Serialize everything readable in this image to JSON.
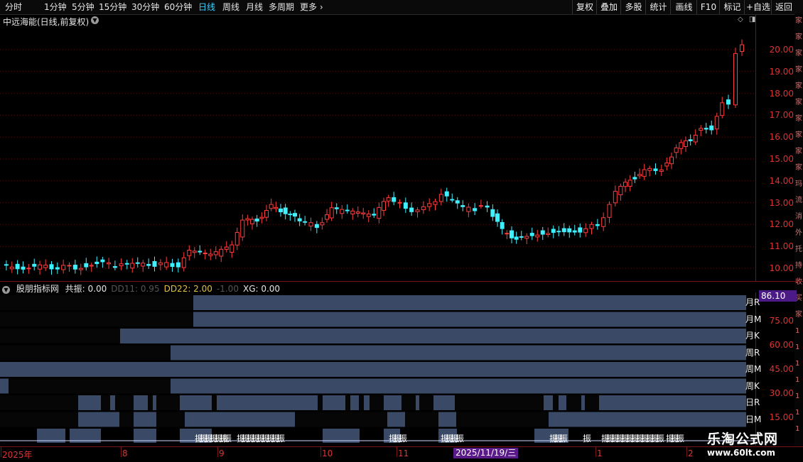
{
  "toolbar": {
    "periods": [
      "分时",
      "1分钟",
      "5分钟",
      "15分钟",
      "30分钟",
      "60分钟",
      "日线",
      "周线",
      "月线",
      "多周期",
      "更多"
    ],
    "active_period": "日线",
    "right_buttons": [
      "复权",
      "叠加",
      "多股",
      "统计",
      "画线",
      "F10",
      "标记",
      "+自选",
      "返回"
    ]
  },
  "stock": {
    "title": "中远海能(日线,前复权)"
  },
  "price_axis": {
    "ticks": [
      "20.00",
      "19.00",
      "18.00",
      "17.00",
      "16.00",
      "15.00",
      "14.00",
      "13.00",
      "12.00",
      "11.00",
      "10.00"
    ]
  },
  "indicator": {
    "name": "股朋指标网",
    "fields": [
      {
        "text": "共振: 0.00",
        "color": "#e6e6e6"
      },
      {
        "text": "DD11: 0.95",
        "color": "#555555"
      },
      {
        "text": "DD22: 2.00",
        "color": "#e0c040"
      },
      {
        "text": "-1.00",
        "color": "#555555"
      },
      {
        "text": "XG: 0.00",
        "color": "#e6e6e6"
      }
    ],
    "highlight_value": "86.10",
    "axis_ticks": [
      "75.00",
      "60.00",
      "45.00",
      "30.00",
      "15.00"
    ],
    "rows": [
      "月R",
      "月M",
      "月K",
      "周R",
      "周M",
      "周K",
      "日R",
      "日M"
    ],
    "signal_label": "振"
  },
  "dates": {
    "labels": [
      "2025年",
      "8",
      "9",
      "10",
      "11",
      "1",
      "2"
    ],
    "cursor": "2025/11/19/三"
  },
  "side_strip": [
    "家",
    "家",
    "家",
    "家",
    "家",
    "家",
    "家",
    "家",
    "家",
    "家",
    "玛",
    "流",
    "消",
    "外",
    "托",
    "持",
    "收",
    "买",
    "家",
    "1",
    "1",
    "1",
    "1",
    "1",
    "1",
    "1"
  ],
  "watermark": {
    "line1": "乐淘公式网",
    "line2": "www.60lt.com"
  },
  "colors": {
    "up": "#ff3d3d",
    "down": "#3ff0ff",
    "axis": "#dd3333",
    "bar": "#3a4a66"
  }
}
